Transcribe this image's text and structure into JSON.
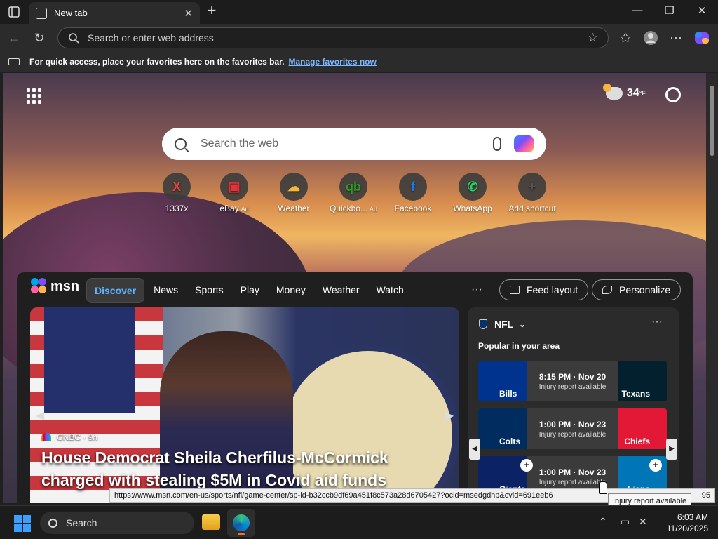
{
  "browser": {
    "tab_title": "New tab",
    "address_placeholder": "Search or enter web address"
  },
  "favorites_bar": {
    "message": "For quick access, place your favorites here on the favorites bar.",
    "link": "Manage favorites now"
  },
  "newtab": {
    "weather_temp": "34",
    "weather_unit": "°F",
    "search_placeholder": "Search the web",
    "shortcuts": [
      {
        "label": "1337x",
        "ad": "",
        "icon": "1337x-icon",
        "glyph": "X",
        "color": "#e8443a"
      },
      {
        "label": "eBay",
        "ad": "Ad",
        "icon": "ebay-bag-icon",
        "glyph": "▣",
        "color": "#e53238"
      },
      {
        "label": "Weather",
        "ad": "",
        "icon": "weather-cloud-icon",
        "glyph": "☁",
        "color": "#f5b63a"
      },
      {
        "label": "Quickbo...",
        "ad": "Ad",
        "icon": "quickbooks-icon",
        "glyph": "qb",
        "color": "#2ca01c"
      },
      {
        "label": "Facebook",
        "ad": "",
        "icon": "facebook-icon",
        "glyph": "f",
        "color": "#1877f2"
      },
      {
        "label": "WhatsApp",
        "ad": "",
        "icon": "whatsapp-icon",
        "glyph": "✆",
        "color": "#25d366"
      },
      {
        "label": "Add shortcut",
        "ad": "",
        "icon": "plus-icon",
        "glyph": "+",
        "color": "#555555"
      }
    ]
  },
  "feed": {
    "brand": "msn",
    "nav": [
      "Discover",
      "News",
      "Sports",
      "Play",
      "Money",
      "Weather",
      "Watch"
    ],
    "active_nav": "Discover",
    "feed_layout_label": "Feed layout",
    "personalize_label": "Personalize",
    "hero": {
      "source": "CNBC",
      "age": "9h",
      "headline": "House Democrat Sheila Cherfilus-McCormick charged with stealing $5M in Covid aid funds"
    },
    "nfl": {
      "title": "NFL",
      "subtitle": "Popular in your area",
      "games": [
        {
          "home": "Bills",
          "away": "Texans",
          "time": "8:15 PM · Nov 20",
          "note": "Injury report available",
          "left_color": "#00338d",
          "right_color": "#03202f"
        },
        {
          "home": "Colts",
          "away": "Chiefs",
          "time": "1:00 PM · Nov 23",
          "note": "Injury report available",
          "left_color": "#002c5f",
          "right_color": "#e31837"
        },
        {
          "home": "Giants",
          "away": "Lions",
          "time": "1:00 PM · Nov 23",
          "note": "Injury report available",
          "left_color": "#0b2265",
          "right_color": "#0076b6"
        }
      ]
    }
  },
  "status": {
    "url": "https://www.msn.com/en-us/sports/nfl/game-center/sp-id-b32ccb9df69a451f8c573a28d6705427?ocid=msedgdhp&cvid=691eeb6",
    "url_tail": "95",
    "tooltip": "Injury report available"
  },
  "taskbar": {
    "search_label": "Search",
    "time": "6:03 AM",
    "date": "11/20/2025"
  }
}
